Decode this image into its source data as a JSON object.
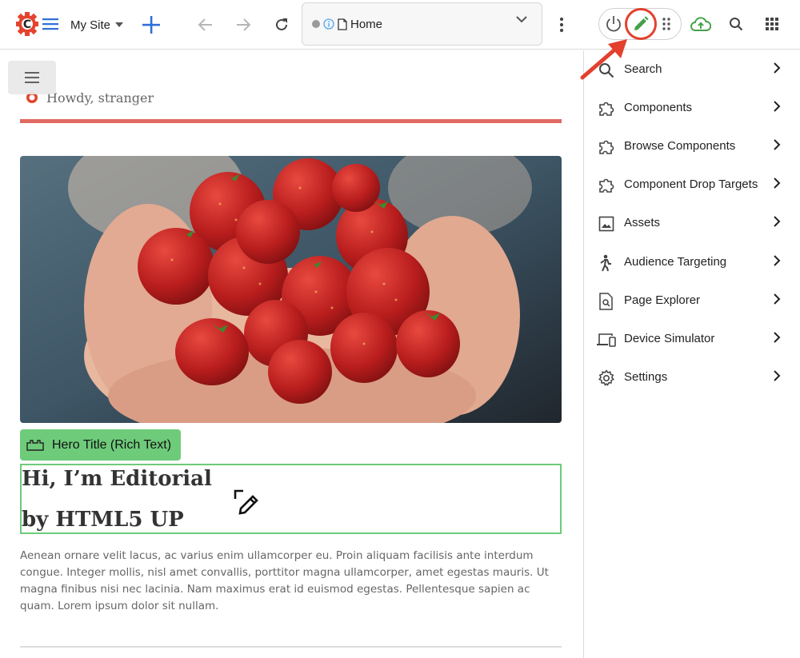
{
  "toolbar": {
    "site_name": "My Site",
    "address_text": "Home",
    "icons": {
      "logo": "crafter-logo-icon",
      "menu": "hamburger-icon",
      "add": "plus-icon",
      "back": "arrow-left-icon",
      "forward": "arrow-right-icon",
      "reload": "refresh-icon",
      "more": "kebab-icon",
      "power": "power-icon",
      "edit": "pencil-icon",
      "drag": "grip-icon",
      "publish": "cloud-upload-icon",
      "search": "search-icon",
      "apps": "apps-grid-icon"
    }
  },
  "content": {
    "greeting": "Howdy, stranger",
    "hero_badge": "Hero Title (Rich Text)",
    "hero_title_line1": "Hi, I’m Editorial",
    "hero_title_line2": "by HTML5 UP",
    "paragraph": "Aenean ornare velit lacus, ac varius enim ullamcorper eu. Proin aliquam facilisis ante interdum congue. Integer mollis, nisl amet convallis, porttitor magna ullamcorper, amet egestas mauris. Ut magna finibus nisi nec lacinia. Nam maximus erat id euismod egestas. Pellentesque sapien ac quam. Lorem ipsum dolor sit nullam."
  },
  "panel": {
    "items": [
      {
        "label": "Search",
        "icon": "search-icon"
      },
      {
        "label": "Components",
        "icon": "puzzle-icon"
      },
      {
        "label": "Browse Components",
        "icon": "puzzle-icon"
      },
      {
        "label": "Component Drop Targets",
        "icon": "puzzle-icon"
      },
      {
        "label": "Assets",
        "icon": "image-icon"
      },
      {
        "label": "Audience Targeting",
        "icon": "person-icon"
      },
      {
        "label": "Page Explorer",
        "icon": "page-search-icon"
      },
      {
        "label": "Device Simulator",
        "icon": "devices-icon"
      },
      {
        "label": "Settings",
        "icon": "gear-icon"
      }
    ]
  },
  "colors": {
    "accent_blue": "#2f6fdb",
    "logo_red": "#e5432f",
    "edit_green": "#43a047",
    "highlight_red": "#e3402e",
    "hero_green": "#6ecb7a",
    "rule_red": "#e06a63"
  }
}
